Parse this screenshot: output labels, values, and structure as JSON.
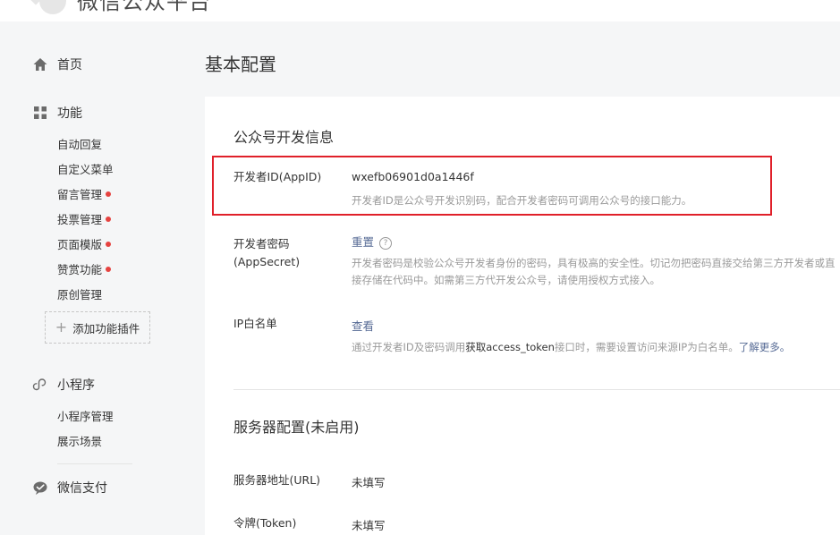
{
  "header": {
    "site_title": "微信公众平台"
  },
  "sidebar": {
    "home": "首页",
    "features": {
      "label": "功能",
      "items": [
        {
          "label": "自动回复",
          "dot": false
        },
        {
          "label": "自定义菜单",
          "dot": false
        },
        {
          "label": "留言管理",
          "dot": true
        },
        {
          "label": "投票管理",
          "dot": true
        },
        {
          "label": "页面模版",
          "dot": true
        },
        {
          "label": "赞赏功能",
          "dot": true
        },
        {
          "label": "原创管理",
          "dot": false
        }
      ],
      "add_plugin": "添加功能插件"
    },
    "miniprogram": {
      "label": "小程序",
      "items": [
        "小程序管理",
        "展示场景"
      ]
    },
    "pay": "微信支付"
  },
  "main": {
    "page_title": "基本配置",
    "dev_info": {
      "title": "公众号开发信息",
      "appid": {
        "label": "开发者ID(AppID)",
        "value": "wxefb06901d0a1446f",
        "desc": "开发者ID是公众号开发识别码，配合开发者密码可调用公众号的接口能力。"
      },
      "appsecret": {
        "label_line1": "开发者密码",
        "label_line2": "(AppSecret)",
        "action": "重置",
        "help": "?",
        "desc": "开发者密码是校验公众号开发者身份的密码，具有极高的安全性。切记勿把密码直接交给第三方开发者或直接存储在代码中。如需第三方代开发公众号，请使用授权方式接入。"
      },
      "ip_whitelist": {
        "label": "IP白名单",
        "action": "查看",
        "desc_prefix": "通过开发者ID及密码调用",
        "desc_link": "获取access_token",
        "desc_middle": "接口时，需要设置访问来源IP为白名单。",
        "desc_more": "了解更多。"
      }
    },
    "server_config": {
      "title": "服务器配置(未启用)",
      "url": {
        "label": "服务器地址(URL)",
        "value": "未填写"
      },
      "token": {
        "label": "令牌(Token)",
        "value": "未填写"
      }
    }
  },
  "colors": {
    "accent_link": "#576b95",
    "highlight_border": "#e0202a",
    "red_dot": "#e64340"
  }
}
